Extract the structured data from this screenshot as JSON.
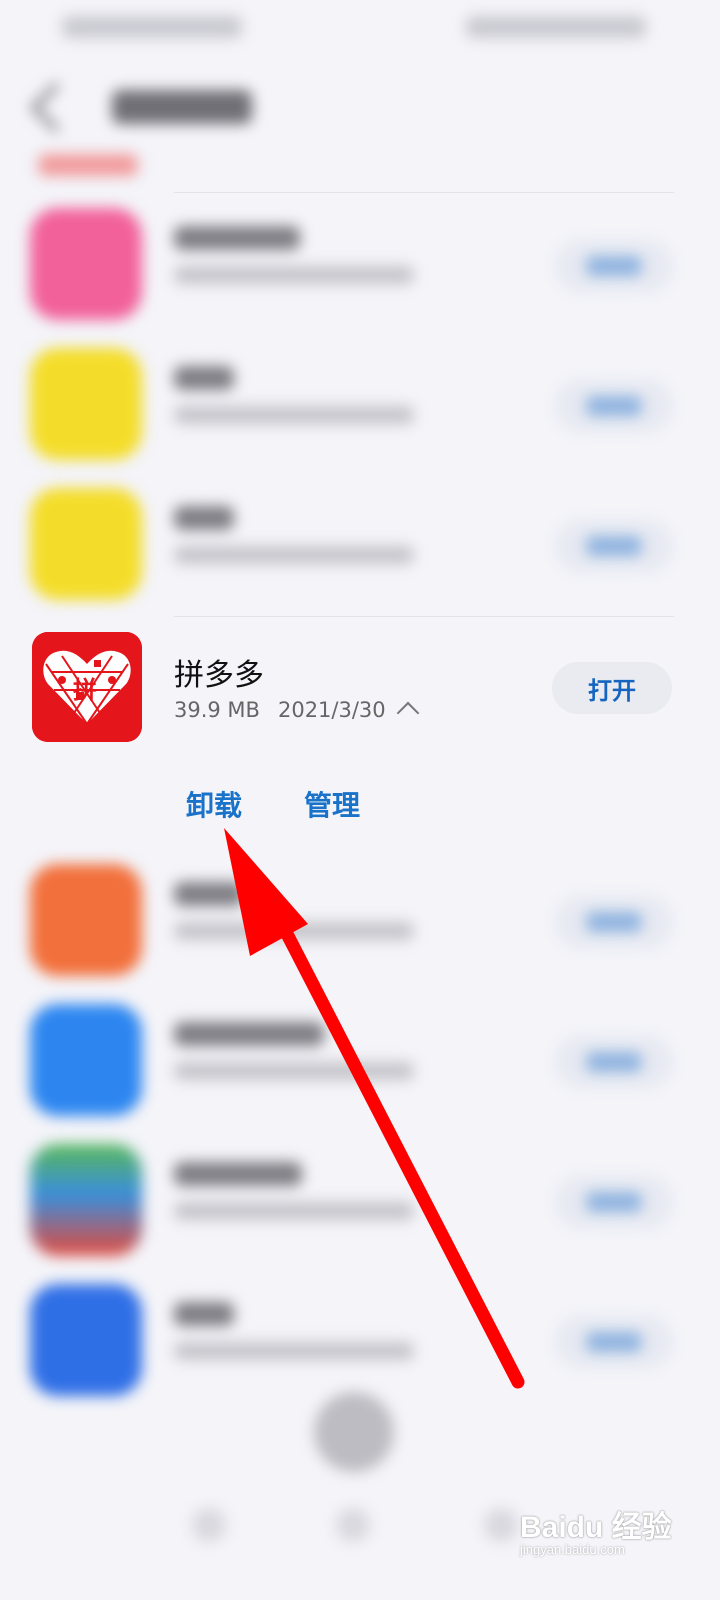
{
  "featured_app": {
    "name": "拼多多",
    "size": "39.9 MB",
    "date": "2021/3/30",
    "open_label": "打开",
    "icon_text": "拼",
    "brand_color": "#e4151b"
  },
  "actions": {
    "uninstall_label": "卸载",
    "manage_label": "管理"
  },
  "blurred_apps": [
    {
      "icon": "blurred-app-icon",
      "color": "#f2619a"
    },
    {
      "icon": "blurred-app-icon",
      "color": "#f4dd2a"
    },
    {
      "icon": "blurred-app-icon",
      "color": "#f4dd2a"
    },
    {
      "icon": "blurred-app-icon",
      "color": "#f2703c"
    },
    {
      "icon": "blurred-app-icon",
      "color": "#2d86f0"
    },
    {
      "icon": "blurred-app-icon",
      "color": "#58b85a"
    },
    {
      "icon": "blurred-app-icon",
      "color": "#2f6fe6"
    }
  ],
  "annotation": {
    "arrow_color": "#ff0000",
    "arrow_icon": "red-arrow-annotation-icon"
  },
  "watermark": {
    "main": "Baidu 经验",
    "sub": "jingyan.baidu.com"
  }
}
